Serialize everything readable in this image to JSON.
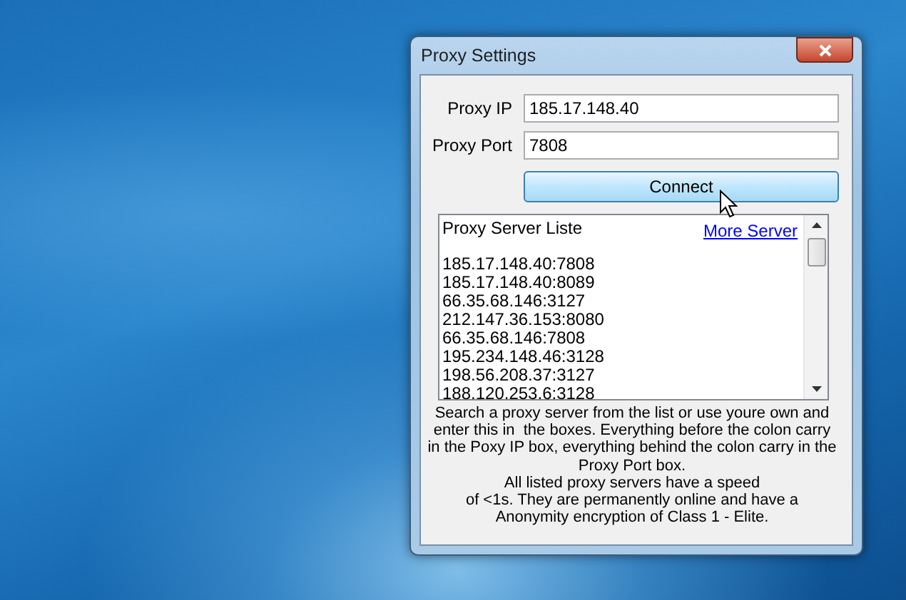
{
  "window": {
    "title": "Proxy Settings"
  },
  "fields": [
    {
      "label": "Proxy IP",
      "value": "185.17.148.40"
    },
    {
      "label": "Proxy Port",
      "value": "7808"
    }
  ],
  "connect_button": {
    "label": "Connect"
  },
  "server_list": {
    "heading": "Proxy Server Liste",
    "link": "More Server",
    "items": [
      "185.17.148.40:7808",
      "185.17.148.40:8089",
      "66.35.68.146:3127",
      "212.147.36.153:8080",
      "66.35.68.146:7808",
      "195.234.148.46:3128",
      "198.56.208.37:3127",
      "188.120.253.6:3128"
    ]
  },
  "description": "Search a proxy server from the list or use youre own and\nenter this in  the boxes. Everything before the colon carry\nin the Poxy IP box, everything behind the colon carry in the\nProxy Port box.\nAll listed proxy servers have a speed\nof <1s. They are permanently online and have a\nAnonymity encryption of Class 1 - Elite."
}
